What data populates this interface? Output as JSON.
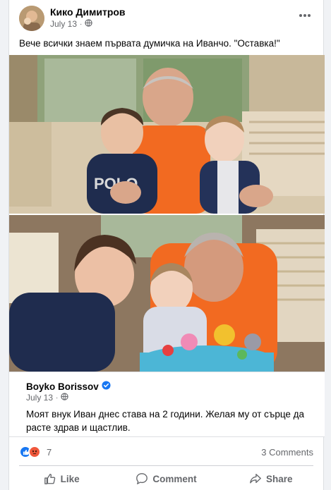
{
  "post": {
    "author": "Кико Димитров",
    "date": "July 13",
    "separator": "·",
    "text": "Вече всички знаем първата думичка на Иванчо. \"Оставка!\"",
    "audience_icon": "globe-icon"
  },
  "shared": {
    "author": "Boyko Borissov",
    "verified_icon": "verified-badge-icon",
    "date": "July 13",
    "separator": "·",
    "text": "Моят внук Иван днес става на 2 години. Желая му от сърце да расте здрав и щастлив."
  },
  "stats": {
    "reaction_count": "7",
    "reaction_icons": [
      "like-icon",
      "angry-icon"
    ],
    "comments": "3 Comments"
  },
  "actions": {
    "like": "Like",
    "comment": "Comment",
    "share": "Share"
  },
  "colors": {
    "like_blue": "#1877f2",
    "angry_orange": "#f7b125",
    "muted_text": "#65676b",
    "orange_shirt": "#f26a21"
  }
}
